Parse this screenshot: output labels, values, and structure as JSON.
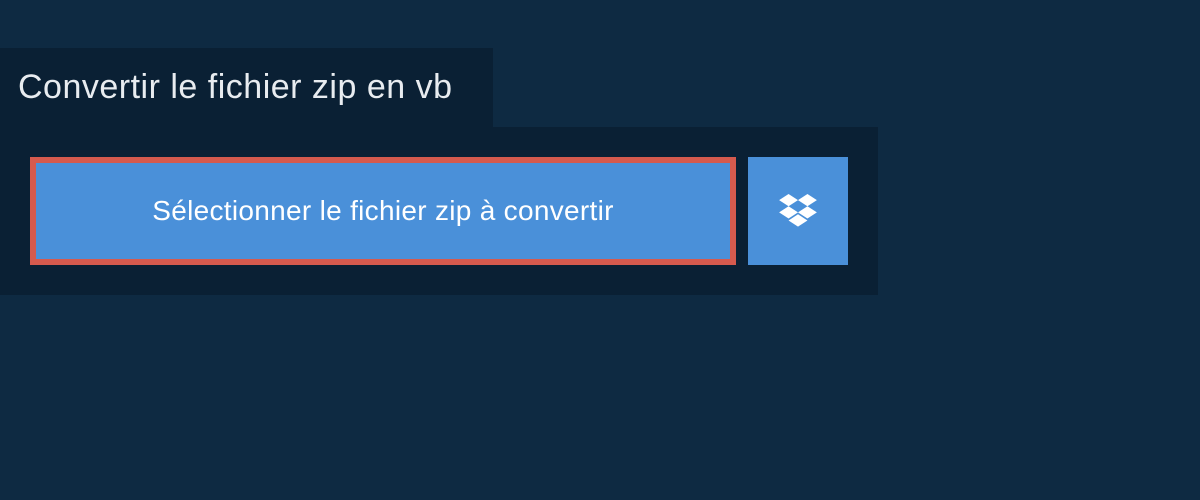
{
  "header": {
    "title": "Convertir le fichier zip en vb"
  },
  "actions": {
    "select_file_label": "Sélectionner le fichier zip à convertir",
    "dropbox_icon": "dropbox-icon"
  },
  "colors": {
    "background": "#0e2a42",
    "panel": "#0a2034",
    "button_primary": "#4a90d9",
    "button_highlight_border": "#d55a4e",
    "text_light": "#e8ecf0"
  }
}
